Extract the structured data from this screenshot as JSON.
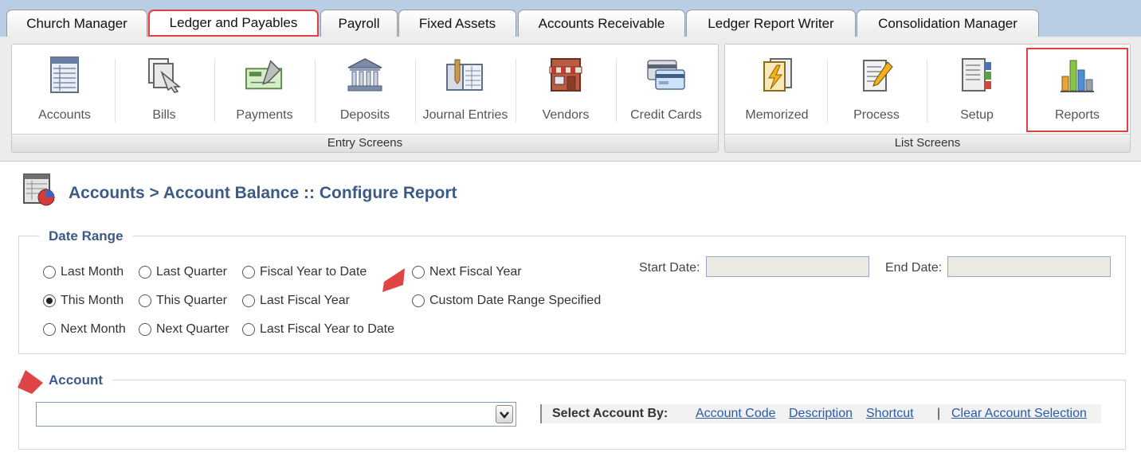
{
  "tabs": [
    {
      "label": "Church Manager",
      "active": false
    },
    {
      "label": "Ledger and Payables",
      "active": true
    },
    {
      "label": "Payroll",
      "active": false
    },
    {
      "label": "Fixed Assets",
      "active": false
    },
    {
      "label": "Accounts Receivable",
      "active": false
    },
    {
      "label": "Ledger Report Writer",
      "active": false
    },
    {
      "label": "Consolidation Manager",
      "active": false
    }
  ],
  "toolbar": {
    "entry_group": {
      "footer": "Entry Screens",
      "buttons": [
        {
          "label": "Accounts",
          "icon": "accounts-list-icon"
        },
        {
          "label": "Bills",
          "icon": "bills-icon"
        },
        {
          "label": "Payments",
          "icon": "payments-check-icon"
        },
        {
          "label": "Deposits",
          "icon": "bank-building-icon"
        },
        {
          "label": "Journal Entries",
          "icon": "journal-ledger-icon"
        },
        {
          "label": "Vendors",
          "icon": "storefront-icon"
        },
        {
          "label": "Credit Cards",
          "icon": "credit-card-icon"
        }
      ]
    },
    "list_group": {
      "footer": "List Screens",
      "buttons": [
        {
          "label": "Memorized",
          "icon": "lightning-document-icon"
        },
        {
          "label": "Process",
          "icon": "pencil-document-icon"
        },
        {
          "label": "Setup",
          "icon": "setup-document-icon"
        },
        {
          "label": "Reports",
          "icon": "bar-chart-icon"
        }
      ]
    }
  },
  "page": {
    "title": "Accounts > Account Balance :: Configure Report",
    "icon": "report-spreadsheet-icon"
  },
  "date_range": {
    "legend": "Date Range",
    "options": {
      "last_month": "Last Month",
      "last_quarter": "Last Quarter",
      "fiscal_year_to_date": "Fiscal Year to Date",
      "next_fiscal_year": "Next Fiscal Year",
      "this_month": "This Month",
      "this_quarter": "This Quarter",
      "last_fiscal_year": "Last Fiscal Year",
      "custom_range": "Custom Date Range Specified",
      "next_month": "Next Month",
      "next_quarter": "Next Quarter",
      "last_fiscal_year_to_date": "Last Fiscal Year to Date"
    },
    "selected": "This Month",
    "start_label": "Start Date:",
    "start_value": "",
    "end_label": "End Date:",
    "end_value": ""
  },
  "account": {
    "legend": "Account",
    "selected_value": "",
    "select_by_label": "Select Account By:",
    "links": {
      "account_code": "Account Code",
      "description": "Description",
      "shortcut": "Shortcut",
      "clear": "Clear Account Selection"
    },
    "separator": "|"
  },
  "colors": {
    "tab_strip": "#b9cde5",
    "highlight": "#e04040",
    "heading": "#3c5a86",
    "link": "#2b5aa5",
    "annotation_arrow": "#e04545"
  }
}
